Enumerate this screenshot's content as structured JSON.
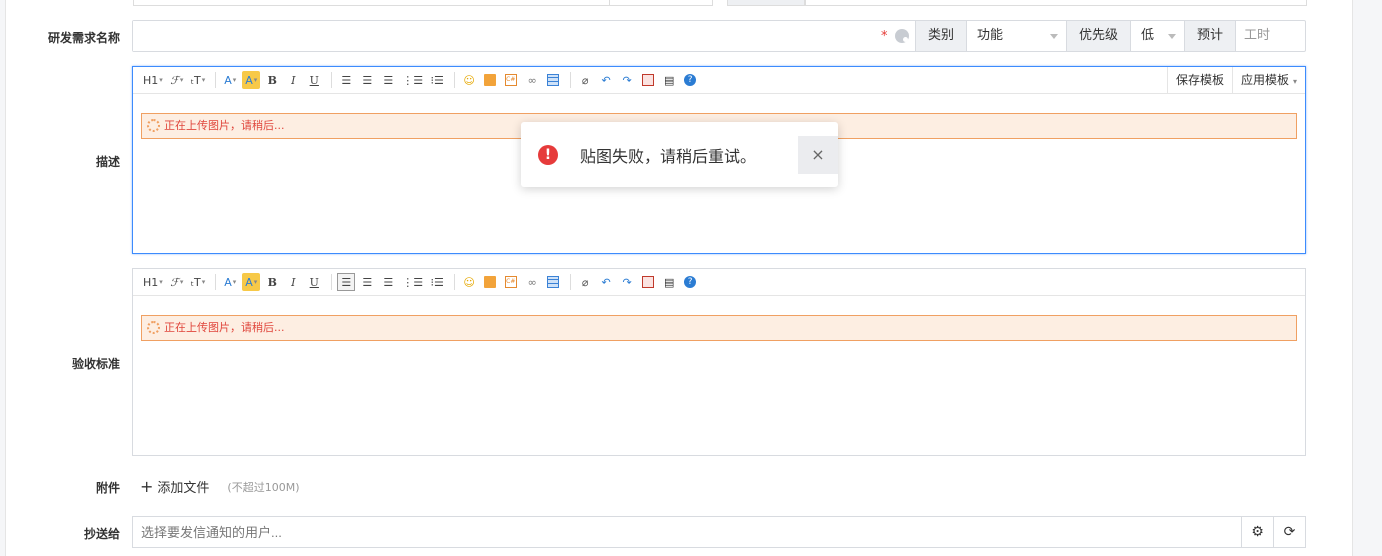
{
  "form": {
    "title_label": "研发需求名称",
    "title_value": "",
    "category_label": "类别",
    "category_value": "功能",
    "priority_label": "优先级",
    "priority_value": "低",
    "estimate_label": "预计",
    "estimate_placeholder": "工时",
    "description_label": "描述",
    "acceptance_label": "验收标准",
    "attachments_label": "附件",
    "cc_label": "抄送给"
  },
  "toolbar": {
    "heading": "H1",
    "font": "ℱ",
    "font_size": "ₜT",
    "font_color": "A",
    "highlight": "A",
    "bold": "B",
    "italic": "I",
    "underline": "U",
    "save_template": "保存模板",
    "apply_template": "应用模板"
  },
  "upload_status": "正在上传图片，请稍后...",
  "toast": {
    "icon": "!",
    "message": "贴图失败，请稍后重试。",
    "close": "×"
  },
  "attachments": {
    "add_file": "添加文件",
    "hint": "(不超过100M)"
  },
  "cc": {
    "placeholder": "选择要发信通知的用户..."
  },
  "colors": {
    "focus_border": "#3d8bfd",
    "error": "#e63b3b",
    "upload_bg": "#fdeee2",
    "upload_border": "#f0a062"
  }
}
